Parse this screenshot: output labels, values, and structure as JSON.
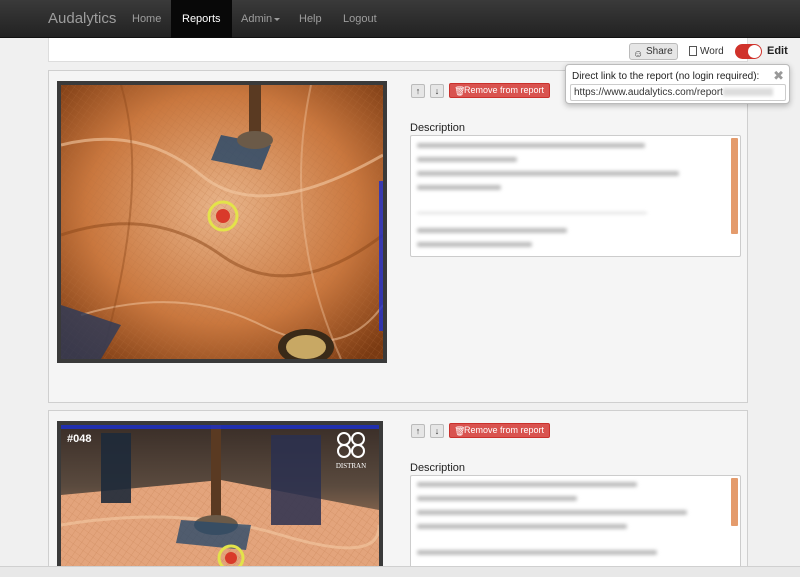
{
  "app": {
    "brand": "Audalytics"
  },
  "nav": {
    "home": "Home",
    "reports": "Reports",
    "admin": "Admin",
    "help": "Help",
    "logout": "Logout"
  },
  "toolbar": {
    "share": "Share",
    "word": "Word",
    "edit": "Edit",
    "edit_on": true
  },
  "popover": {
    "title": "Direct link to the report (no login required):",
    "url": "https://www.audalytics.com/report"
  },
  "cards": [
    {
      "remove": "Remove from report",
      "desc_label": "Description",
      "photo_label": ""
    },
    {
      "remove": "Remove from report",
      "desc_label": "Description",
      "photo_label": "#048",
      "logo_text": "DISTRAN"
    }
  ],
  "colors": {
    "navbar": "#222222",
    "danger": "#d9534f",
    "toggle": "#d0322b",
    "scrollbar": "#e49b6c"
  }
}
